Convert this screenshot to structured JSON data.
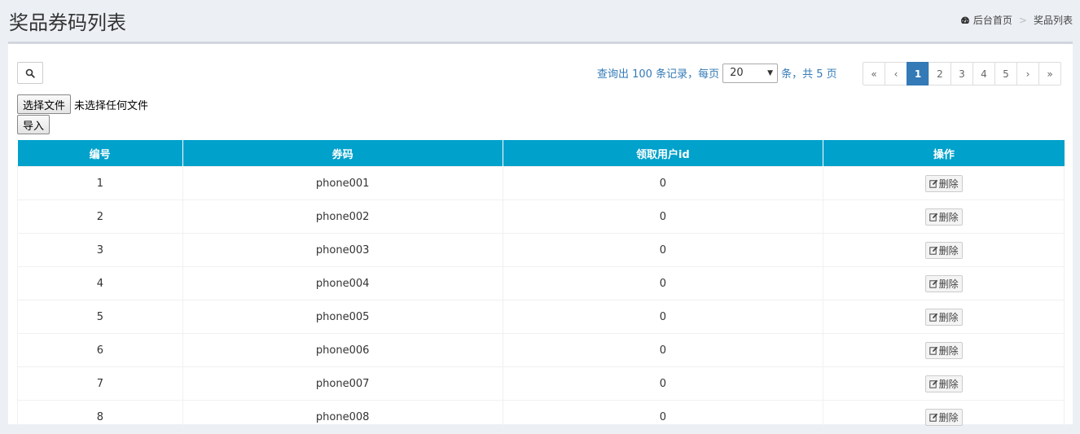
{
  "header": {
    "title": "奖品券码列表",
    "breadcrumb": [
      {
        "label": "后台首页",
        "icon": "dashboard-icon"
      },
      {
        "label": "奖品列表"
      }
    ],
    "breadcrumb_separator": ">"
  },
  "toolbar": {
    "search_icon": "search-icon",
    "pager": {
      "prefix": "查询出 100 条记录，每页",
      "page_size": "20",
      "suffix": "条，共 5 页"
    },
    "pagination": [
      "«",
      "‹",
      "1",
      "2",
      "3",
      "4",
      "5",
      "›",
      "»"
    ],
    "active_page": "1"
  },
  "upload": {
    "choose_file_label": "选择文件",
    "file_status": "未选择任何文件",
    "import_label": "导入"
  },
  "table": {
    "columns": [
      "编号",
      "券码",
      "领取用户id",
      "操作"
    ],
    "rows": [
      {
        "id": "1",
        "code": "phone001",
        "user_id": "0",
        "action": "删除"
      },
      {
        "id": "2",
        "code": "phone002",
        "user_id": "0",
        "action": "删除"
      },
      {
        "id": "3",
        "code": "phone003",
        "user_id": "0",
        "action": "删除"
      },
      {
        "id": "4",
        "code": "phone004",
        "user_id": "0",
        "action": "删除"
      },
      {
        "id": "5",
        "code": "phone005",
        "user_id": "0",
        "action": "删除"
      },
      {
        "id": "6",
        "code": "phone006",
        "user_id": "0",
        "action": "删除"
      },
      {
        "id": "7",
        "code": "phone007",
        "user_id": "0",
        "action": "删除"
      },
      {
        "id": "8",
        "code": "phone008",
        "user_id": "0",
        "action": "删除"
      }
    ]
  },
  "colors": {
    "header_bg": "#00a1cb",
    "active_page": "#337ab7",
    "page_bg": "#ecf0f5"
  }
}
